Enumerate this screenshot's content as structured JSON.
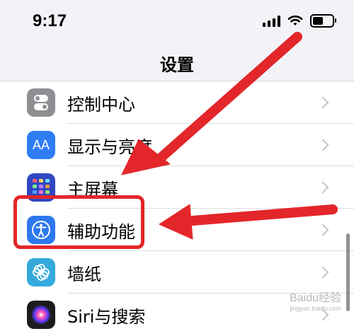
{
  "status_bar": {
    "time": "9:17"
  },
  "nav": {
    "title": "设置"
  },
  "settings": {
    "items": [
      {
        "label": "控制中心",
        "icon": "control-center-icon",
        "color": "#8e8e93"
      },
      {
        "label": "显示与亮度",
        "icon": "display-brightness-icon",
        "color": "#2f7cf6",
        "glyph": "AA"
      },
      {
        "label": "主屏幕",
        "icon": "home-screen-icon",
        "color": "#3047c4"
      },
      {
        "label": "辅助功能",
        "icon": "accessibility-icon",
        "color": "#2e78f0"
      },
      {
        "label": "墙纸",
        "icon": "wallpaper-icon",
        "color": "#34aadc"
      },
      {
        "label": "Siri与搜索",
        "icon": "siri-icon",
        "color": "#1c1c1e"
      }
    ]
  },
  "annotation": {
    "highlight_color": "#e3262a"
  },
  "watermark": {
    "text": "Baidu经验",
    "sub": "jingyan.baidu.com"
  }
}
